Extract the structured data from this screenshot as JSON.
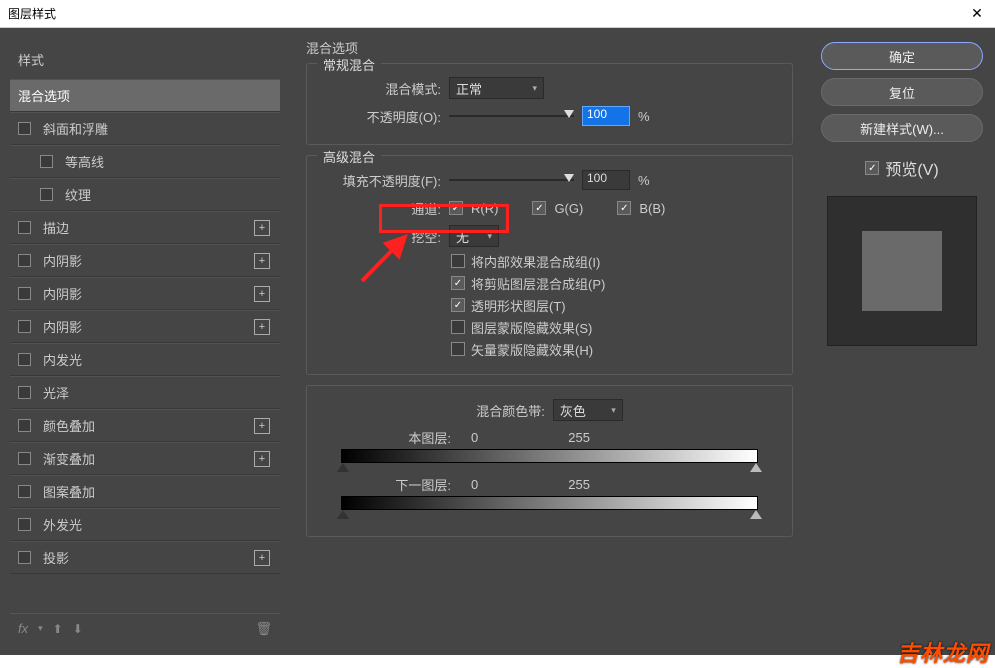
{
  "titlebar": {
    "title": "图层样式"
  },
  "sidebar": {
    "heading": "样式",
    "items": [
      {
        "label": "混合选项",
        "selected": true,
        "cb": false,
        "plus": false,
        "indent": false
      },
      {
        "label": "斜面和浮雕",
        "selected": false,
        "cb": true,
        "plus": false,
        "indent": false
      },
      {
        "label": "等高线",
        "selected": false,
        "cb": true,
        "plus": false,
        "indent": true
      },
      {
        "label": "纹理",
        "selected": false,
        "cb": true,
        "plus": false,
        "indent": true
      },
      {
        "label": "描边",
        "selected": false,
        "cb": true,
        "plus": true,
        "indent": false
      },
      {
        "label": "内阴影",
        "selected": false,
        "cb": true,
        "plus": true,
        "indent": false
      },
      {
        "label": "内阴影",
        "selected": false,
        "cb": true,
        "plus": true,
        "indent": false
      },
      {
        "label": "内阴影",
        "selected": false,
        "cb": true,
        "plus": true,
        "indent": false
      },
      {
        "label": "内发光",
        "selected": false,
        "cb": true,
        "plus": false,
        "indent": false
      },
      {
        "label": "光泽",
        "selected": false,
        "cb": true,
        "plus": false,
        "indent": false
      },
      {
        "label": "颜色叠加",
        "selected": false,
        "cb": true,
        "plus": true,
        "indent": false
      },
      {
        "label": "渐变叠加",
        "selected": false,
        "cb": true,
        "plus": true,
        "indent": false
      },
      {
        "label": "图案叠加",
        "selected": false,
        "cb": true,
        "plus": false,
        "indent": false
      },
      {
        "label": "外发光",
        "selected": false,
        "cb": true,
        "plus": false,
        "indent": false
      },
      {
        "label": "投影",
        "selected": false,
        "cb": true,
        "plus": true,
        "indent": false
      }
    ],
    "footer": {
      "fx": "fx"
    }
  },
  "main": {
    "heading": "混合选项",
    "general": {
      "legend": "常规混合",
      "blend_mode_label": "混合模式:",
      "blend_mode_value": "正常",
      "opacity_label": "不透明度(O):",
      "opacity_value": "100",
      "opacity_unit": "%"
    },
    "advanced": {
      "legend": "高级混合",
      "fill_opacity_label": "填充不透明度(F):",
      "fill_opacity_value": "100",
      "fill_opacity_unit": "%",
      "channels_label": "通道:",
      "r": "R(R)",
      "g": "G(G)",
      "b": "B(B)",
      "knockout_label": "挖空:",
      "knockout_value": "无",
      "opts": [
        {
          "label": "将内部效果混合成组(I)",
          "on": false
        },
        {
          "label": "将剪贴图层混合成组(P)",
          "on": true
        },
        {
          "label": "透明形状图层(T)",
          "on": true
        },
        {
          "label": "图层蒙版隐藏效果(S)",
          "on": false
        },
        {
          "label": "矢量蒙版隐藏效果(H)",
          "on": false
        }
      ]
    },
    "blend_if": {
      "label": "混合颜色带:",
      "value": "灰色",
      "this_layer": "本图层:",
      "this_low": "0",
      "this_high": "255",
      "under_layer": "下一图层:",
      "under_low": "0",
      "under_high": "255"
    }
  },
  "right": {
    "ok": "确定",
    "cancel": "复位",
    "new_style": "新建样式(W)...",
    "preview": "预览(V)"
  },
  "watermark": "吉林龙网"
}
